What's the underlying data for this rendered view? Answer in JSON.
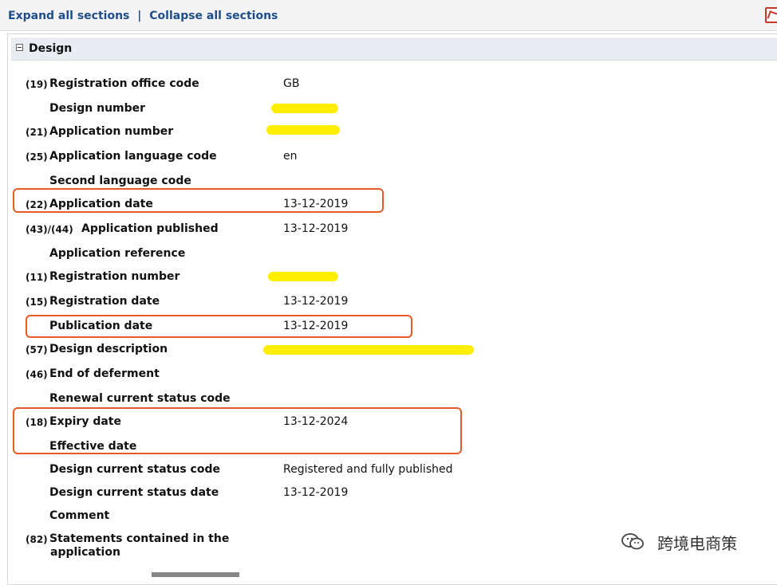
{
  "toolbar": {
    "expand_label": "Expand all sections",
    "separator": "|",
    "collapse_label": "Collapse all sections"
  },
  "section": {
    "title": "Design"
  },
  "rows": {
    "r1": {
      "code": "(19)",
      "label": "Registration office code",
      "value": "GB"
    },
    "r2": {
      "code": "",
      "label": "Design number",
      "value": ""
    },
    "r3": {
      "code": "(21)",
      "label": "Application number",
      "value": ""
    },
    "r4": {
      "code": "(25)",
      "label": "Application language code",
      "value": "en"
    },
    "r5": {
      "code": "",
      "label": "Second language code",
      "value": ""
    },
    "r6": {
      "code": "(22)",
      "label": "Application date",
      "value": "13-12-2019"
    },
    "r7": {
      "code": "(43)/(44)",
      "label": "Application published",
      "value": "13-12-2019"
    },
    "r8": {
      "code": "",
      "label": "Application reference",
      "value": ""
    },
    "r9": {
      "code": "(11)",
      "label": "Registration number",
      "value": ""
    },
    "r10": {
      "code": "(15)",
      "label": "Registration date",
      "value": "13-12-2019"
    },
    "r11": {
      "code": "",
      "label": "Publication date",
      "value": "13-12-2019"
    },
    "r12": {
      "code": "(57)",
      "label": "Design description",
      "value": ""
    },
    "r13": {
      "code": "(46)",
      "label": "End of deferment",
      "value": ""
    },
    "r14": {
      "code": "",
      "label": "Renewal current status code",
      "value": ""
    },
    "r15": {
      "code": "(18)",
      "label": "Expiry date",
      "value": "13-12-2024"
    },
    "r16": {
      "code": "",
      "label": "Effective date",
      "value": ""
    },
    "r17": {
      "code": "",
      "label": "Design current status code",
      "value": "Registered and fully published"
    },
    "r18": {
      "code": "",
      "label": "Design current status date",
      "value": "13-12-2019"
    },
    "r19": {
      "code": "",
      "label": "Comment",
      "value": ""
    },
    "r20": {
      "code": "(82)",
      "label_line1": "Statements contained in the",
      "label_line2": "application",
      "value": ""
    }
  },
  "watermark": {
    "text": "跨境电商策",
    "icon": "wechat-icon"
  },
  "colors": {
    "link": "#1f4e8c",
    "highlight_box": "#e85a2a",
    "redaction": "#ffee00",
    "section_header_bg": "#e9edf1"
  }
}
